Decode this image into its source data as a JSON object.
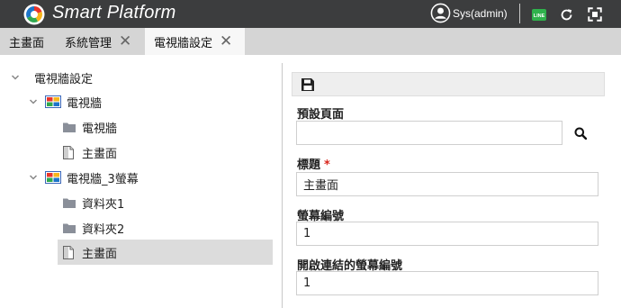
{
  "header": {
    "brand": "Smart Platform",
    "user_name": "Sys(admin)",
    "line_badge": "LINE"
  },
  "tabs": [
    {
      "label": "主畫面",
      "closable": false,
      "active": false
    },
    {
      "label": "系統管理",
      "closable": true,
      "active": false
    },
    {
      "label": "電視牆設定",
      "closable": true,
      "active": true
    }
  ],
  "tree": {
    "root": {
      "label": "電視牆設定",
      "expanded": true
    },
    "nodes": [
      {
        "label": "電視牆",
        "type": "wall",
        "expanded": true
      },
      {
        "label": "電視牆",
        "type": "folder"
      },
      {
        "label": "主畫面",
        "type": "page"
      },
      {
        "label": "電視牆_3螢幕",
        "type": "wall",
        "expanded": true
      },
      {
        "label": "資料夾1",
        "type": "folder"
      },
      {
        "label": "資料夾2",
        "type": "folder"
      },
      {
        "label": "主畫面",
        "type": "page",
        "selected": true
      }
    ]
  },
  "form": {
    "default_page": {
      "label": "預設頁面",
      "value": ""
    },
    "title": {
      "label": "標題",
      "required_mark": "*",
      "value": "主畫面"
    },
    "screen_no": {
      "label": "螢幕編號",
      "value": "1"
    },
    "open_linked_screen_no": {
      "label": "開啟連結的螢幕編號",
      "value": "1"
    }
  },
  "colors": {
    "header_bg": "#3c3d3e",
    "tab_bar_bg": "#d5d5d5",
    "active_tab_bg": "#f7f7f7",
    "selected_row_bg": "#dcdcdc",
    "required": "#d9261c",
    "line_green": "#2fb24c"
  }
}
